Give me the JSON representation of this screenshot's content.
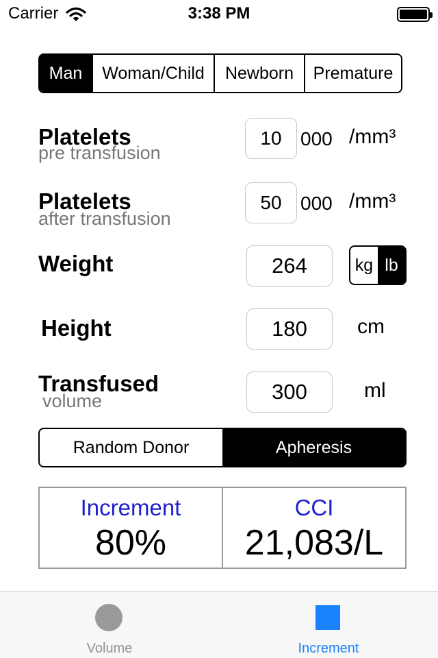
{
  "status_bar": {
    "carrier": "Carrier",
    "time": "3:38 PM"
  },
  "patient_type": {
    "options": [
      "Man",
      "Woman/Child",
      "Newborn",
      "Premature"
    ],
    "selected": "Man"
  },
  "platelets_pre": {
    "label": "Platelets",
    "sublabel": "pre transfusion",
    "value": "10",
    "suffix": "000",
    "unit": "/mm³"
  },
  "platelets_after": {
    "label": "Platelets",
    "sublabel": "after transfusion",
    "value": "50",
    "suffix": "000",
    "unit": "/mm³"
  },
  "weight": {
    "label": "Weight",
    "value": "264",
    "unit_options": [
      "kg",
      "lb"
    ],
    "unit_selected": "lb"
  },
  "height": {
    "label": "Height",
    "value": "180",
    "unit": "cm"
  },
  "transfused_volume": {
    "label": "Transfused",
    "sublabel": "volume",
    "value": "300",
    "unit": "ml"
  },
  "donor_type": {
    "options": [
      "Random Donor",
      "Apheresis"
    ],
    "selected": "Apheresis"
  },
  "results": {
    "increment": {
      "label": "Increment",
      "value": "80%"
    },
    "cci": {
      "label": "CCI",
      "value": "21,083/L"
    }
  },
  "tab_bar": {
    "tabs": [
      {
        "label": "Volume",
        "icon": "circle-icon",
        "active": false
      },
      {
        "label": "Increment",
        "icon": "square-icon",
        "active": true
      }
    ]
  },
  "colors": {
    "accent_blue": "#1a82fb",
    "result_label_blue": "#1f1fd0",
    "sublabel_gray": "#777777"
  }
}
